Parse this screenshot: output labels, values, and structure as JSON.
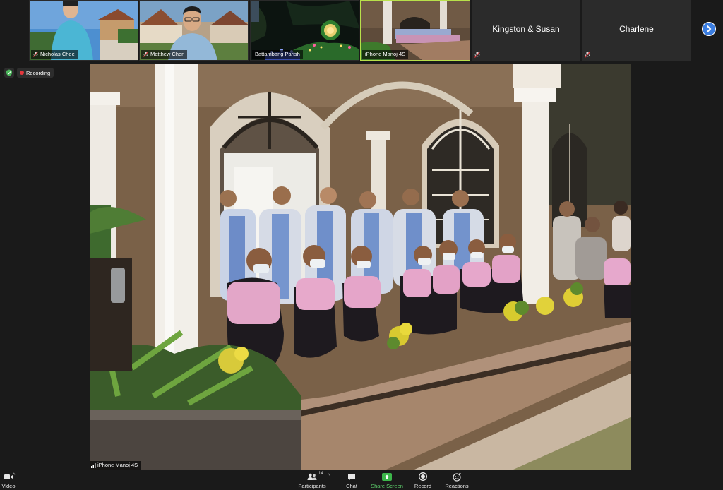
{
  "participants": [
    {
      "id": "nicholas",
      "name": "Nicholas Chee",
      "mic_muted": true
    },
    {
      "id": "matthew",
      "name": "Matthew Chen",
      "mic_muted": true
    },
    {
      "id": "battambang",
      "name": "Battambang Parish",
      "mic_muted": false
    },
    {
      "id": "manoj",
      "name": "iPhone Manoj 4S",
      "mic_muted": false,
      "active_speaker": true
    },
    {
      "id": "kingston",
      "name": "Kingston & Susan",
      "video_off": true,
      "mic_muted": true
    },
    {
      "id": "charlene",
      "name": "Charlene",
      "video_off": true,
      "mic_muted": true
    }
  ],
  "recording": {
    "label": "Recording"
  },
  "main_video": {
    "speaker_name": "iPhone Manoj 4S"
  },
  "toolbar": {
    "video": {
      "label": "Video",
      "icon": "video-camera-icon"
    },
    "participants": {
      "label": "Participants",
      "count": "14",
      "icon": "people-icon"
    },
    "chat": {
      "label": "Chat",
      "icon": "chat-bubble-icon"
    },
    "share": {
      "label": "Share Screen",
      "icon": "share-screen-icon"
    },
    "record": {
      "label": "Record",
      "icon": "record-icon"
    },
    "reactions": {
      "label": "Reactions",
      "icon": "emoji-icon"
    }
  },
  "colors": {
    "background": "#1a1a1a",
    "active_speaker_border": "#b8e04a",
    "share_green": "#5fd16d",
    "recording_red": "#e5373d",
    "next_page_blue": "#3b7de0"
  }
}
